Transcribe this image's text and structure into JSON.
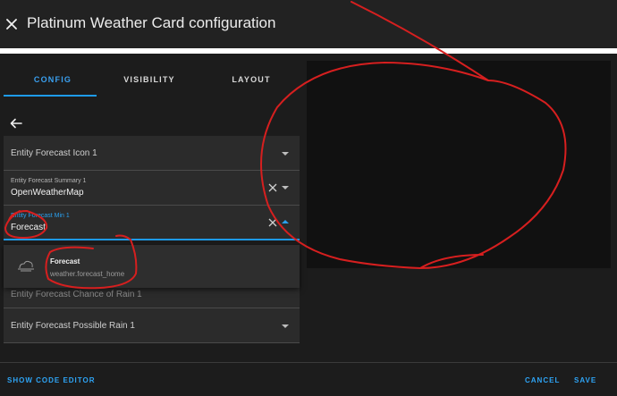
{
  "dialog": {
    "title": "Platinum Weather Card configuration"
  },
  "tabs": [
    {
      "label": "CONFIG",
      "active": true
    },
    {
      "label": "VISIBILITY",
      "active": false
    },
    {
      "label": "LAYOUT",
      "active": false
    }
  ],
  "fields": {
    "icon": {
      "label": "Entity Forecast Icon 1",
      "value": ""
    },
    "summary": {
      "label": "Entity Forecast Summary 1",
      "value": "OpenWeatherMap"
    },
    "min": {
      "label": "Entity Forecast Min 1",
      "value": "Forecast"
    },
    "chance": {
      "label": "Entity Forecast Chance of Rain 1",
      "value": ""
    },
    "possible_rain": {
      "label": "Entity Forecast Possible Rain 1",
      "value": ""
    }
  },
  "dropdown": {
    "option": {
      "name": "Forecast",
      "entity": "weather.forecast_home"
    }
  },
  "footer": {
    "show_code_editor": "SHOW CODE EDITOR",
    "cancel": "CANCEL",
    "save": "SAVE"
  },
  "colors": {
    "accent": "#1e9be9",
    "background": "#1c1c1c",
    "field": "#2b2b2b",
    "annotation": "#d61f1f"
  },
  "icons": [
    "close-icon",
    "arrow-left-icon",
    "chevron-down-icon",
    "chevron-up-icon",
    "clear-icon",
    "weather-entity-icon"
  ]
}
